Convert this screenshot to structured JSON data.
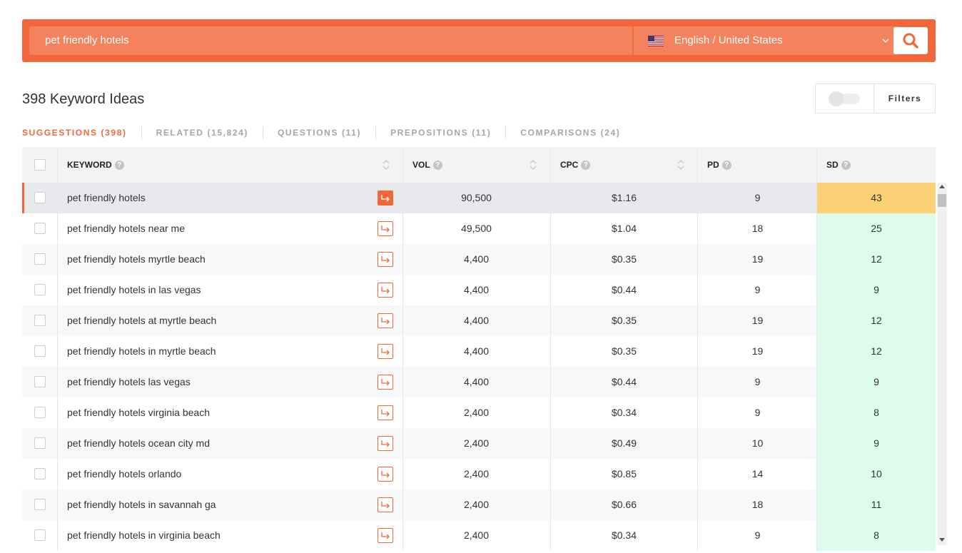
{
  "search": {
    "value": "pet friendly hotels",
    "language": "English / United States",
    "search_icon": "search-icon",
    "flag_icon": "us-flag-icon"
  },
  "header": {
    "title": "398 Keyword Ideas",
    "filters_label": "Filters"
  },
  "tabs": [
    {
      "label": "SUGGESTIONS (398)",
      "active": true
    },
    {
      "label": "RELATED (15,824)",
      "active": false
    },
    {
      "label": "QUESTIONS (11)",
      "active": false
    },
    {
      "label": "PREPOSITIONS (11)",
      "active": false
    },
    {
      "label": "COMPARISONS (24)",
      "active": false
    }
  ],
  "table": {
    "columns": {
      "keyword": "KEYWORD",
      "vol": "VOL",
      "cpc": "CPC",
      "pd": "PD",
      "sd": "SD"
    },
    "rows": [
      {
        "keyword": "pet friendly hotels",
        "vol": "90,500",
        "cpc": "$1.16",
        "pd": "9",
        "sd": "43"
      },
      {
        "keyword": "pet friendly hotels near me",
        "vol": "49,500",
        "cpc": "$1.04",
        "pd": "18",
        "sd": "25"
      },
      {
        "keyword": "pet friendly hotels myrtle beach",
        "vol": "4,400",
        "cpc": "$0.35",
        "pd": "19",
        "sd": "12"
      },
      {
        "keyword": "pet friendly hotels in las vegas",
        "vol": "4,400",
        "cpc": "$0.44",
        "pd": "9",
        "sd": "9"
      },
      {
        "keyword": "pet friendly hotels at myrtle beach",
        "vol": "4,400",
        "cpc": "$0.35",
        "pd": "19",
        "sd": "12"
      },
      {
        "keyword": "pet friendly hotels in myrtle beach",
        "vol": "4,400",
        "cpc": "$0.35",
        "pd": "19",
        "sd": "12"
      },
      {
        "keyword": "pet friendly hotels las vegas",
        "vol": "4,400",
        "cpc": "$0.44",
        "pd": "9",
        "sd": "9"
      },
      {
        "keyword": "pet friendly hotels virginia beach",
        "vol": "2,400",
        "cpc": "$0.34",
        "pd": "9",
        "sd": "8"
      },
      {
        "keyword": "pet friendly hotels ocean city md",
        "vol": "2,400",
        "cpc": "$0.49",
        "pd": "10",
        "sd": "9"
      },
      {
        "keyword": "pet friendly hotels orlando",
        "vol": "2,400",
        "cpc": "$0.85",
        "pd": "14",
        "sd": "10"
      },
      {
        "keyword": "pet friendly hotels in savannah ga",
        "vol": "2,400",
        "cpc": "$0.66",
        "pd": "18",
        "sd": "11"
      },
      {
        "keyword": "pet friendly hotels in virginia beach",
        "vol": "2,400",
        "cpc": "$0.34",
        "pd": "9",
        "sd": "8"
      }
    ]
  },
  "colors": {
    "accent": "#f2673a",
    "sd_high": "#fdd176",
    "sd_low": "#ddfcec"
  }
}
